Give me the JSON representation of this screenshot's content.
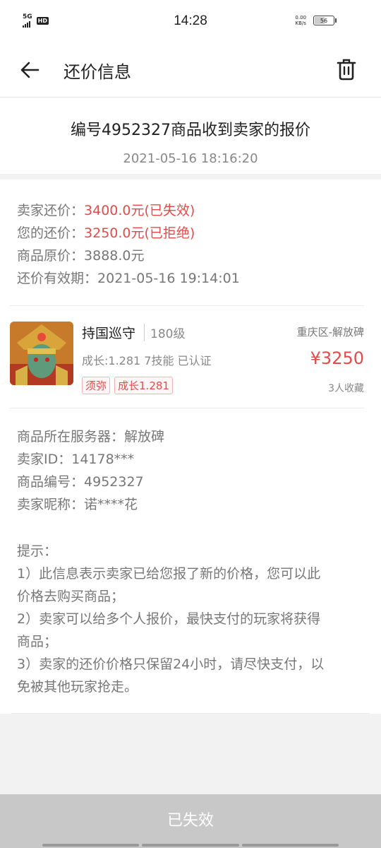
{
  "status_bar": {
    "network": "5G",
    "hd": "HD",
    "time": "14:28",
    "net_speed_value": "0.00",
    "net_speed_unit": "KB/s",
    "battery": "56",
    "battery_level": 0.56
  },
  "nav": {
    "title": "还价信息",
    "back_icon": "arrow-left-icon",
    "delete_icon": "trash-icon"
  },
  "header": {
    "title": "编号4952327商品收到卖家的报价",
    "time": "2021-05-16 18:16:20"
  },
  "prices": {
    "seller_label": "卖家还价：",
    "seller_value": "3400.0元(已失效)",
    "mine_label": "您的还价：",
    "mine_value": "3250.0元(已拒绝)",
    "original_label": "商品原价：",
    "original_value": "3888.0元",
    "valid_label": "还价有效期：",
    "valid_value": "2021-05-16 19:14:01"
  },
  "goods": {
    "name": "持国巡守",
    "level": "180级",
    "region": "重庆区-解放碑",
    "attrs": "成长:1.281 7技能 已认证",
    "price": "¥3250",
    "tags": [
      "须弥",
      "成长1.281"
    ],
    "favorites": "3人收藏"
  },
  "info": {
    "server_label": "商品所在服务器：",
    "server_value": "解放碑",
    "seller_id_label": "卖家ID：",
    "seller_id_value": "14178***",
    "goods_no_label": "商品编号：",
    "goods_no_value": "4952327",
    "nickname_label": "卖家昵称：",
    "nickname_value": "诺****花"
  },
  "tips": {
    "heading": "提示：",
    "line1": "1）此信息表示卖家已给您报了新的价格，您可以此",
    "line1b": "价格去购买商品；",
    "line2": "2）卖家可以给多个人报价，最快支付的玩家将获得",
    "line2b": "商品；",
    "line3": "3）卖家的还价价格只保留24小时，请尽快支付，以",
    "line3b": "免被其他玩家抢走。"
  },
  "bottom_button": {
    "label": "已失效"
  },
  "colors": {
    "accent_red": "#e34b4b",
    "disabled_button": "#c8c8c8"
  }
}
